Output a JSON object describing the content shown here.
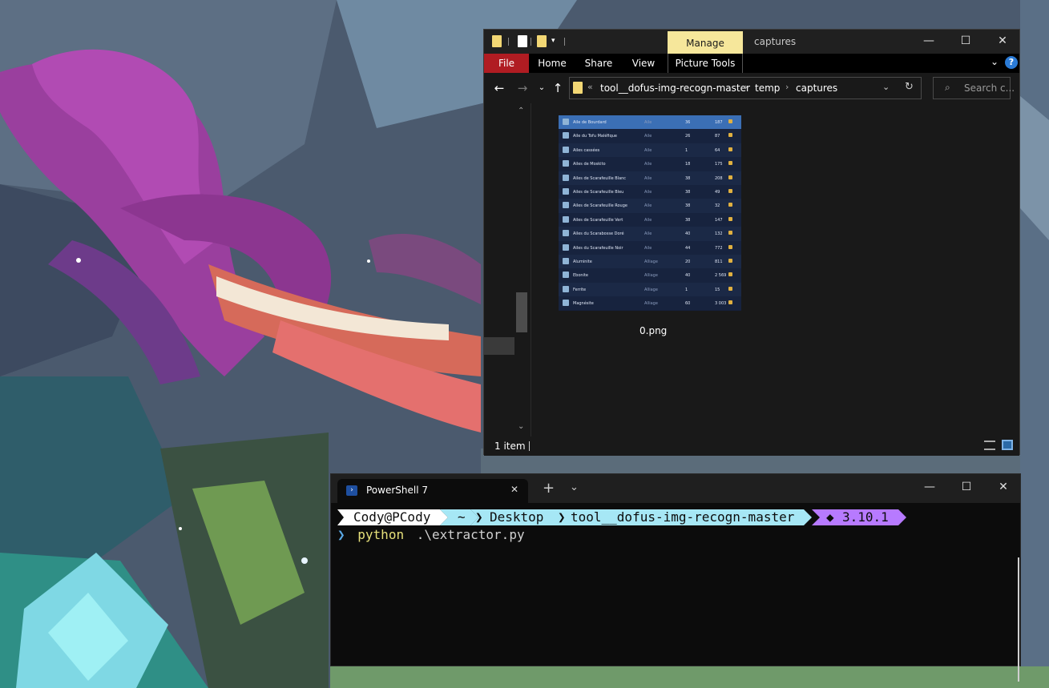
{
  "explorer": {
    "title": "captures",
    "manage_tab": "Manage",
    "ribbon_tabs": [
      "File",
      "Home",
      "Share",
      "View",
      "Picture Tools"
    ],
    "help_glyph": "?",
    "breadcrumb": [
      "tool__dofus-img-recogn-master",
      "temp",
      "captures"
    ],
    "breadcrumb_overflow": "«",
    "search_placeholder": "Search c...",
    "file": {
      "name": "0.png",
      "thumbnail_rows": [
        {
          "name": "Aile de Bourdard",
          "type": "Aile",
          "level": "36",
          "price": "187"
        },
        {
          "name": "Aile du Tofu Maléfique",
          "type": "Aile",
          "level": "26",
          "price": "87"
        },
        {
          "name": "Ailes cassées",
          "type": "Aile",
          "level": "1",
          "price": "64"
        },
        {
          "name": "Ailes de Moskito",
          "type": "Aile",
          "level": "18",
          "price": "175"
        },
        {
          "name": "Ailes de Scarafeuille Blanc",
          "type": "Aile",
          "level": "38",
          "price": "208"
        },
        {
          "name": "Ailes de Scarafeuille Bleu",
          "type": "Aile",
          "level": "38",
          "price": "49"
        },
        {
          "name": "Ailes de Scarafeuille Rouge",
          "type": "Aile",
          "level": "38",
          "price": "32"
        },
        {
          "name": "Ailes de Scarafeuille Vert",
          "type": "Aile",
          "level": "38",
          "price": "147"
        },
        {
          "name": "Ailes du Scarabosse Doré",
          "type": "Aile",
          "level": "40",
          "price": "132"
        },
        {
          "name": "Ailes du Scarafeuille Noir",
          "type": "Aile",
          "level": "44",
          "price": "772"
        },
        {
          "name": "Aluminite",
          "type": "Alliage",
          "level": "20",
          "price": "811"
        },
        {
          "name": "Ebonite",
          "type": "Alliage",
          "level": "40",
          "price": "2 569"
        },
        {
          "name": "Ferrite",
          "type": "Alliage",
          "level": "1",
          "price": "15"
        },
        {
          "name": "Magnésite",
          "type": "Alliage",
          "level": "60",
          "price": "3 003"
        }
      ]
    },
    "status": "1 item"
  },
  "terminal": {
    "tab_title": "PowerShell 7",
    "prompt": {
      "user": "Cody@PCody",
      "home": "~",
      "dir1": "Desktop",
      "dir2": "tool__dofus-img-recogn-master",
      "python": "3.10.1"
    },
    "command_name": "python",
    "command_arg": ".\\extractor.py"
  }
}
